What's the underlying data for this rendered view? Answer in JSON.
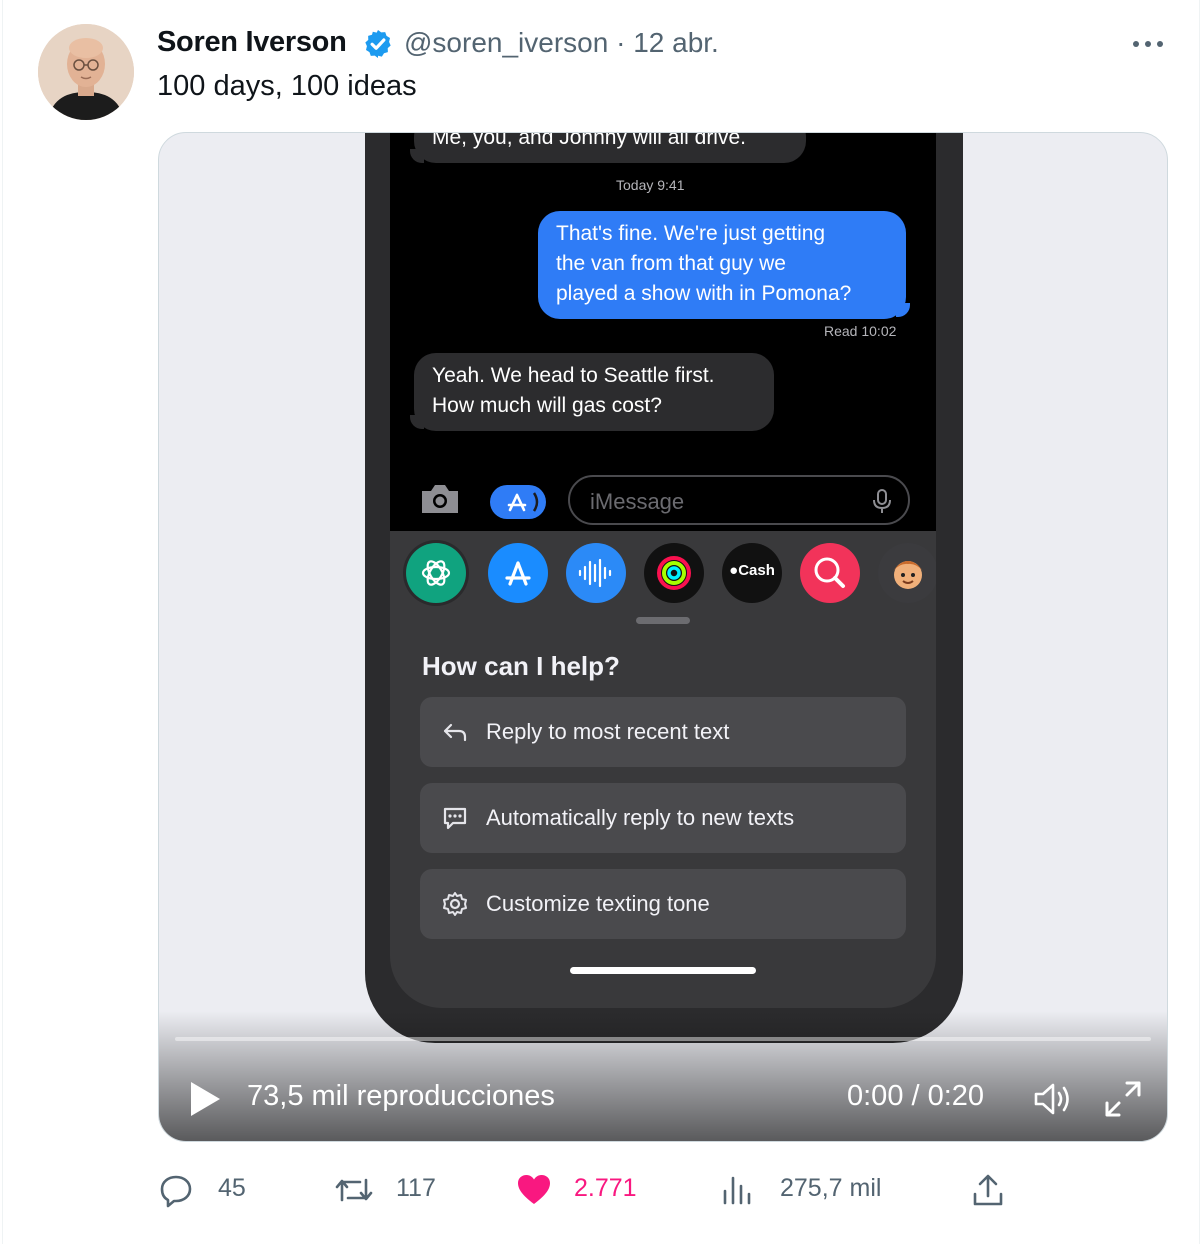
{
  "author": {
    "name": "Soren Iverson",
    "handle": "@soren_iverson",
    "date": "12 abr."
  },
  "tweet": {
    "text": "100 days, 100 ideas"
  },
  "video": {
    "chat": {
      "msg1": "Me, you, and Johnny will all drive.",
      "timestamp": "Today 9:41",
      "msg2_line1": "That's fine. We're just getting",
      "msg2_line2": "the van from that guy we",
      "msg2_line3": "played a show with in Pomona?",
      "read": "Read 10:02",
      "msg3_line1": "Yeah. We head to Seattle first.",
      "msg3_line2": "How much will gas cost?",
      "input_placeholder": "iMessage"
    },
    "tray": {
      "cash_label": "Cash"
    },
    "panel": {
      "title": "How can I help?",
      "options": [
        "Reply to most recent text",
        "Automatically reply to new texts",
        "Customize texting tone"
      ]
    },
    "controls": {
      "views": "73,5 mil reproducciones",
      "time": "0:00 / 0:20",
      "progress": 0
    }
  },
  "actions": {
    "replies": "45",
    "retweets": "117",
    "likes": "2.771",
    "views": "275,7 mil"
  },
  "colors": {
    "verified": "#1d9bf0",
    "like": "#f91880",
    "imessage_blue": "#2f7cf6",
    "secondary_text": "#536471"
  }
}
